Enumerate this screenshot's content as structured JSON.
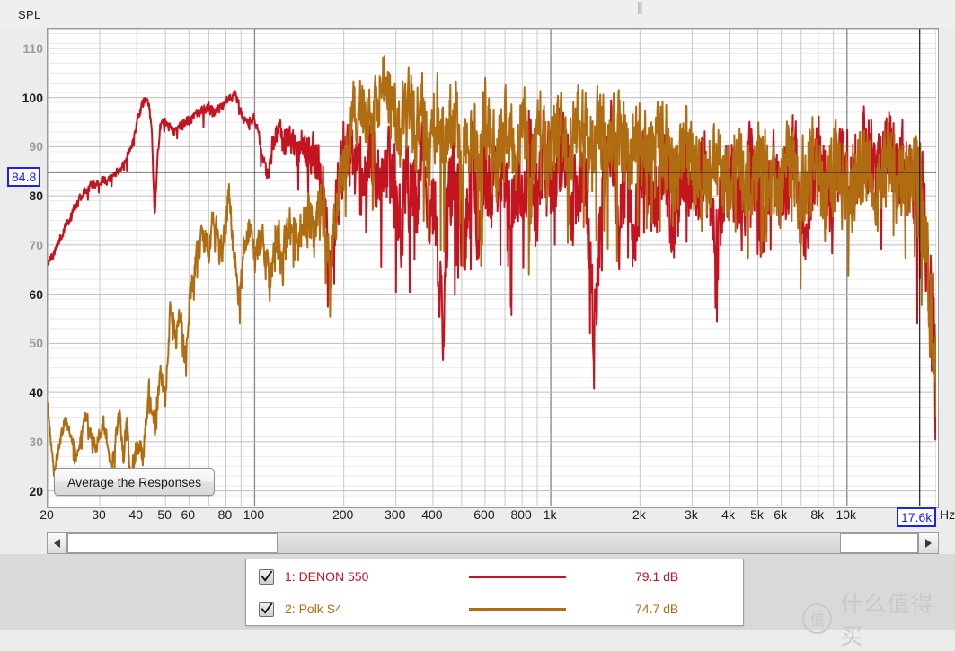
{
  "app": {
    "spl_axis_title": "SPL",
    "hz_axis_title": "Hz"
  },
  "readouts": {
    "spl_cursor": "84.8",
    "freq_cursor": "17.6k"
  },
  "buttons": {
    "average_responses": "Average the Responses",
    "scroll_left": "◀",
    "scroll_right": "▶"
  },
  "legend": {
    "rows": [
      {
        "index": "1",
        "label": "1: DENON 550",
        "color": "#c3141f",
        "value": "79.1 dB",
        "checked": true
      },
      {
        "index": "2",
        "label": "2: Polk S4",
        "color": "#b06c10",
        "value": "74.7 dB",
        "checked": true
      }
    ]
  },
  "watermark": {
    "mark": "值",
    "text": "什么值得买"
  },
  "chart_data": {
    "type": "line",
    "title": "",
    "xlabel": "Hz",
    "ylabel": "SPL",
    "xscale": "log",
    "xlim": [
      20,
      20000
    ],
    "ylim": [
      17,
      114
    ],
    "grid": true,
    "legend_position": "bottom",
    "cursor": {
      "freq_hz": 17600,
      "spl_db": 84.8
    },
    "yticks": [
      {
        "value": 110,
        "label": "110",
        "emphasis": "minor"
      },
      {
        "value": 100,
        "label": "100",
        "emphasis": "major"
      },
      {
        "value": 90,
        "label": "90",
        "emphasis": "minor"
      },
      {
        "value": 80,
        "label": "80",
        "emphasis": "major"
      },
      {
        "value": 70,
        "label": "70",
        "emphasis": "minor"
      },
      {
        "value": 60,
        "label": "60",
        "emphasis": "major"
      },
      {
        "value": 50,
        "label": "50",
        "emphasis": "minor"
      },
      {
        "value": 40,
        "label": "40",
        "emphasis": "major"
      },
      {
        "value": 30,
        "label": "30",
        "emphasis": "minor"
      },
      {
        "value": 20,
        "label": "20",
        "emphasis": "major"
      }
    ],
    "yminor_step": 2,
    "xticks": [
      {
        "value": 20,
        "label": "20"
      },
      {
        "value": 30,
        "label": "30"
      },
      {
        "value": 40,
        "label": "40"
      },
      {
        "value": 50,
        "label": "50"
      },
      {
        "value": 60,
        "label": "60"
      },
      {
        "value": 80,
        "label": "80"
      },
      {
        "value": 100,
        "label": "100"
      },
      {
        "value": 200,
        "label": "200"
      },
      {
        "value": 300,
        "label": "300"
      },
      {
        "value": 400,
        "label": "400"
      },
      {
        "value": 600,
        "label": "600"
      },
      {
        "value": 800,
        "label": "800"
      },
      {
        "value": 1000,
        "label": "1k"
      },
      {
        "value": 2000,
        "label": "2k"
      },
      {
        "value": 3000,
        "label": "3k"
      },
      {
        "value": 4000,
        "label": "4k"
      },
      {
        "value": 5000,
        "label": "5k"
      },
      {
        "value": 6000,
        "label": "6k"
      },
      {
        "value": 8000,
        "label": "8k"
      },
      {
        "value": 10000,
        "label": "10k"
      }
    ],
    "xmajor_decades": [
      100,
      1000,
      10000
    ],
    "series": [
      {
        "name": "1: DENON 550",
        "color": "#c3141f",
        "mean_db": 79.1,
        "anchors": [
          [
            20,
            66
          ],
          [
            22,
            71
          ],
          [
            24,
            76
          ],
          [
            26,
            80
          ],
          [
            28,
            82
          ],
          [
            30,
            83
          ],
          [
            32,
            83.4
          ],
          [
            34,
            84.5
          ],
          [
            36,
            86
          ],
          [
            38,
            89
          ],
          [
            40,
            95
          ],
          [
            42,
            99
          ],
          [
            43,
            100
          ],
          [
            44,
            99
          ],
          [
            45,
            92
          ],
          [
            46,
            75
          ],
          [
            47,
            88
          ],
          [
            48,
            94
          ],
          [
            50,
            95
          ],
          [
            54,
            93
          ],
          [
            58,
            95
          ],
          [
            62,
            96
          ],
          [
            66,
            97
          ],
          [
            70,
            98
          ],
          [
            74,
            97
          ],
          [
            78,
            98
          ],
          [
            82,
            100
          ],
          [
            86,
            101
          ],
          [
            90,
            97
          ],
          [
            95,
            95
          ],
          [
            100,
            96
          ],
          [
            105,
            90
          ],
          [
            110,
            83
          ],
          [
            115,
            90
          ],
          [
            120,
            93
          ],
          [
            130,
            91
          ],
          [
            140,
            89
          ],
          [
            150,
            90
          ],
          [
            160,
            88
          ],
          [
            170,
            83
          ],
          [
            180,
            62
          ],
          [
            190,
            80
          ],
          [
            200,
            90
          ],
          [
            215,
            86
          ],
          [
            230,
            84
          ],
          [
            250,
            88
          ],
          [
            270,
            80
          ],
          [
            290,
            86
          ],
          [
            310,
            74
          ],
          [
            330,
            84
          ],
          [
            350,
            78
          ],
          [
            370,
            86
          ],
          [
            390,
            70
          ],
          [
            400,
            80
          ],
          [
            430,
            56
          ],
          [
            450,
            78
          ],
          [
            480,
            86
          ],
          [
            510,
            70
          ],
          [
            540,
            86
          ],
          [
            570,
            74
          ],
          [
            600,
            88
          ],
          [
            640,
            78
          ],
          [
            680,
            90
          ],
          [
            720,
            72
          ],
          [
            760,
            86
          ],
          [
            800,
            80
          ],
          [
            850,
            88
          ],
          [
            900,
            76
          ],
          [
            950,
            90
          ],
          [
            1000,
            82
          ],
          [
            1100,
            92
          ],
          [
            1200,
            78
          ],
          [
            1300,
            88
          ],
          [
            1400,
            50
          ],
          [
            1500,
            84
          ],
          [
            1600,
            92
          ],
          [
            1700,
            76
          ],
          [
            1800,
            88
          ],
          [
            1900,
            72
          ],
          [
            2000,
            86
          ],
          [
            2200,
            80
          ],
          [
            2400,
            88
          ],
          [
            2600,
            74
          ],
          [
            2800,
            86
          ],
          [
            3000,
            78
          ],
          [
            3300,
            88
          ],
          [
            3600,
            70
          ],
          [
            4000,
            86
          ],
          [
            4400,
            78
          ],
          [
            4800,
            88
          ],
          [
            5200,
            72
          ],
          [
            5600,
            86
          ],
          [
            6000,
            80
          ],
          [
            6600,
            88
          ],
          [
            7200,
            74
          ],
          [
            8000,
            88
          ],
          [
            8800,
            78
          ],
          [
            9600,
            90
          ],
          [
            10500,
            82
          ],
          [
            11500,
            90
          ],
          [
            12500,
            84
          ],
          [
            13500,
            90
          ],
          [
            15000,
            86
          ],
          [
            16500,
            84
          ],
          [
            18000,
            78
          ],
          [
            19000,
            62
          ],
          [
            20000,
            40
          ]
        ],
        "noise_amp": [
          [
            20,
            1.2
          ],
          [
            100,
            1.5
          ],
          [
            180,
            9
          ],
          [
            400,
            14
          ],
          [
            1000,
            13
          ],
          [
            3000,
            12
          ],
          [
            8000,
            12
          ],
          [
            16000,
            11
          ],
          [
            20000,
            18
          ]
        ]
      },
      {
        "name": "2: Polk S4",
        "color": "#b06c10",
        "mean_db": 74.7,
        "anchors": [
          [
            20,
            37
          ],
          [
            21,
            24
          ],
          [
            23,
            35
          ],
          [
            25,
            27
          ],
          [
            27,
            35
          ],
          [
            29,
            28
          ],
          [
            31,
            34
          ],
          [
            33,
            25
          ],
          [
            35,
            35
          ],
          [
            36,
            27
          ],
          [
            37,
            35
          ],
          [
            38,
            22
          ],
          [
            40,
            30
          ],
          [
            42,
            27
          ],
          [
            44,
            40
          ],
          [
            46,
            33
          ],
          [
            48,
            44
          ],
          [
            50,
            39
          ],
          [
            52,
            58
          ],
          [
            54,
            50
          ],
          [
            56,
            57
          ],
          [
            58,
            46
          ],
          [
            60,
            57
          ],
          [
            63,
            66
          ],
          [
            66,
            72
          ],
          [
            70,
            70
          ],
          [
            73,
            76
          ],
          [
            76,
            68
          ],
          [
            79,
            72
          ],
          [
            82,
            81
          ],
          [
            85,
            70
          ],
          [
            88,
            58
          ],
          [
            92,
            70
          ],
          [
            96,
            73
          ],
          [
            100,
            67
          ],
          [
            106,
            73
          ],
          [
            112,
            62
          ],
          [
            118,
            72
          ],
          [
            125,
            68
          ],
          [
            132,
            74
          ],
          [
            140,
            70
          ],
          [
            150,
            78
          ],
          [
            160,
            72
          ],
          [
            170,
            80
          ],
          [
            180,
            66
          ],
          [
            190,
            78
          ],
          [
            200,
            85
          ],
          [
            215,
            97
          ],
          [
            230,
            99
          ],
          [
            245,
            95
          ],
          [
            260,
            101
          ],
          [
            275,
            104
          ],
          [
            290,
            98
          ],
          [
            310,
            94
          ],
          [
            330,
            99
          ],
          [
            350,
            92
          ],
          [
            370,
            98
          ],
          [
            390,
            88
          ],
          [
            410,
            97
          ],
          [
            440,
            90
          ],
          [
            470,
            98
          ],
          [
            500,
            86
          ],
          [
            530,
            94
          ],
          [
            570,
            88
          ],
          [
            610,
            96
          ],
          [
            650,
            86
          ],
          [
            700,
            94
          ],
          [
            750,
            88
          ],
          [
            800,
            96
          ],
          [
            860,
            84
          ],
          [
            920,
            94
          ],
          [
            980,
            88
          ],
          [
            1050,
            96
          ],
          [
            1150,
            90
          ],
          [
            1250,
            97
          ],
          [
            1350,
            88
          ],
          [
            1450,
            96
          ],
          [
            1550,
            90
          ],
          [
            1700,
            95
          ],
          [
            1850,
            88
          ],
          [
            2000,
            93
          ],
          [
            2200,
            86
          ],
          [
            2400,
            92
          ],
          [
            2600,
            84
          ],
          [
            2900,
            90
          ],
          [
            3200,
            82
          ],
          [
            3500,
            88
          ],
          [
            3900,
            80
          ],
          [
            4300,
            88
          ],
          [
            4700,
            82
          ],
          [
            5200,
            88
          ],
          [
            5700,
            80
          ],
          [
            6300,
            88
          ],
          [
            7000,
            82
          ],
          [
            7700,
            88
          ],
          [
            8500,
            80
          ],
          [
            9400,
            88
          ],
          [
            10400,
            82
          ],
          [
            11500,
            88
          ],
          [
            12700,
            82
          ],
          [
            14000,
            88
          ],
          [
            15500,
            82
          ],
          [
            17000,
            84
          ],
          [
            18500,
            72
          ],
          [
            19500,
            52
          ],
          [
            20000,
            38
          ]
        ],
        "noise_amp": [
          [
            20,
            1.5
          ],
          [
            100,
            5
          ],
          [
            200,
            9
          ],
          [
            500,
            13
          ],
          [
            1500,
            12
          ],
          [
            4000,
            12
          ],
          [
            9000,
            12
          ],
          [
            16000,
            12
          ],
          [
            20000,
            16
          ]
        ]
      }
    ]
  }
}
